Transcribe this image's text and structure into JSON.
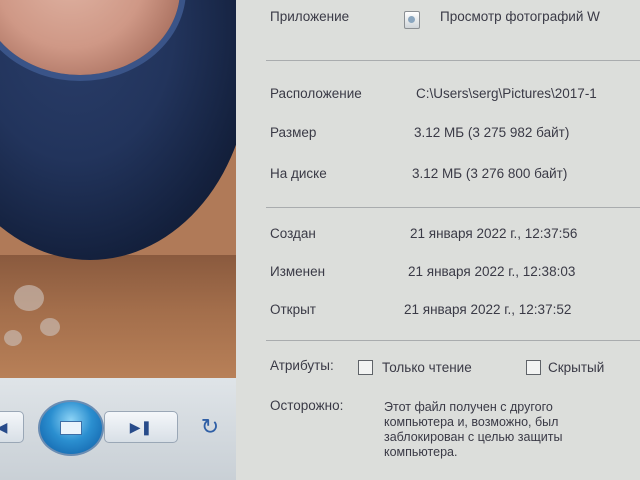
{
  "viewer": {
    "controls": {
      "prev_icon": "previous-icon",
      "play_icon": "slideshow-icon",
      "next_icon": "next-icon",
      "rotate_icon": "rotate-icon"
    }
  },
  "properties": {
    "app_label": "Приложение",
    "app_value": "Просмотр фотографий W",
    "location_label": "Расположение",
    "location_value": "C:\\Users\\serg\\Pictures\\2017-1",
    "size_label": "Размер",
    "size_value": "3.12 МБ (3 275 982 байт)",
    "disk_label": "На диске",
    "disk_value": "3.12 МБ (3 276 800 байт)",
    "created_label": "Создан",
    "created_value": "21 января 2022 г., 12:37:56",
    "modified_label": "Изменен",
    "modified_value": "21 января 2022 г., 12:38:03",
    "opened_label": "Открыт",
    "opened_value": "21 января 2022 г., 12:37:52",
    "attributes_label": "Атрибуты:",
    "readonly_label": "Только чтение",
    "hidden_label": "Скрытый",
    "warning_label": "Осторожно:",
    "warning_text": "Этот файл получен с другого компьютера и, возможно, был заблокирован с целью защиты компьютера."
  }
}
